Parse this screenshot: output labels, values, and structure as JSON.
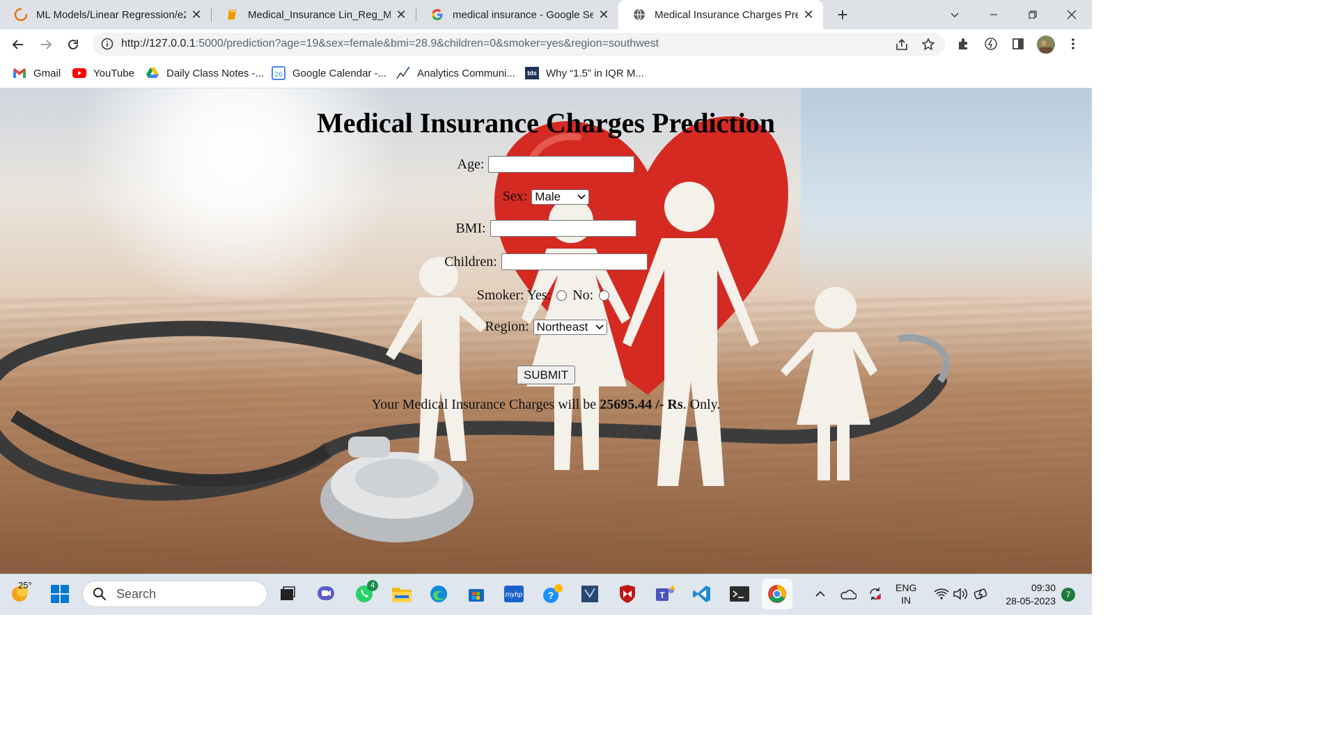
{
  "browser": {
    "tabs": [
      {
        "title": "ML Models/Linear Regression/e2",
        "active": false
      },
      {
        "title": "Medical_Insurance Lin_Reg_Mode",
        "active": false
      },
      {
        "title": "medical insurance - Google Searc",
        "active": false
      },
      {
        "title": "Medical Insurance Charges Predi",
        "active": true
      }
    ],
    "url_host": "http://127.0.0.1",
    "url_rest": ":5000/prediction?age=19&sex=female&bmi=28.9&children=0&smoker=yes&region=southwest",
    "bookmarks": [
      "Gmail",
      "YouTube",
      "Daily Class Notes -...",
      "Google Calendar -...",
      "Analytics Communi...",
      "Why “1.5” in IQR M..."
    ],
    "calendar_day": "26",
    "tds_label": "tds"
  },
  "form": {
    "heading": "Medical Insurance Charges Prediction",
    "age_label": "Age:",
    "sex_label": "Sex:",
    "sex_selected": "Male",
    "bmi_label": "BMI:",
    "children_label": "Children:",
    "smoker_label": "Smoker:",
    "yes_label": "Yes:",
    "no_label": "No:",
    "region_label": "Region:",
    "region_selected": "Northeast",
    "submit_label": "SUBMIT"
  },
  "result": {
    "prefix": "Your Medical Insurance Charges will be",
    "amount": "25695.44",
    "suffix_bold": "/- Rs",
    "suffix_end": ". Only."
  },
  "taskbar": {
    "weather": "25°",
    "search_placeholder": "Search",
    "whatsapp_badge": "4",
    "lang_top": "ENG",
    "lang_bottom": "IN",
    "time": "09:30",
    "date": "28-05-2023",
    "notification_count": "7"
  },
  "colors": {
    "tab_strip": "#dee1e6",
    "taskbar": "#dfe6ee",
    "heart": "#d42a22"
  }
}
